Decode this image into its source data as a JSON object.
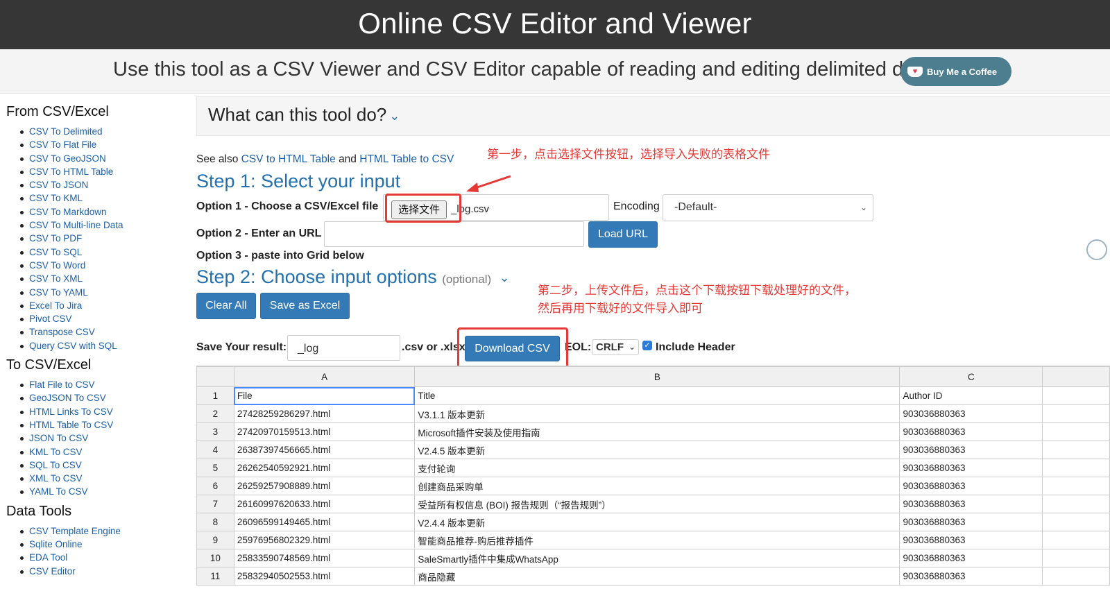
{
  "header": {
    "title": "Online CSV Editor and Viewer",
    "tagline": "Use this tool as a CSV Viewer and CSV Editor capable of reading and editing delimited data.",
    "coffee_label": "Buy Me a Coffee"
  },
  "sidebar": {
    "from_title": "From CSV/Excel",
    "from_items": [
      "CSV To Delimited",
      "CSV To Flat File",
      "CSV To GeoJSON",
      "CSV To HTML Table",
      "CSV To JSON",
      "CSV To KML",
      "CSV To Markdown",
      "CSV To Multi-line Data",
      "CSV To PDF",
      "CSV To SQL",
      "CSV To Word",
      "CSV To XML",
      "CSV To YAML",
      "Excel To Jira",
      "Pivot CSV",
      "Transpose CSV",
      "Query CSV with SQL"
    ],
    "to_title": "To CSV/Excel",
    "to_items": [
      "Flat File to CSV",
      "GeoJSON To CSV",
      "HTML Links To CSV",
      "HTML Table To CSV",
      "JSON To CSV",
      "KML To CSV",
      "SQL To CSV",
      "XML To CSV",
      "YAML To CSV"
    ],
    "tools_title": "Data Tools",
    "tools_items": [
      "CSV Template Engine",
      "Sqlite Online",
      "EDA Tool",
      "CSV Editor"
    ]
  },
  "panel": {
    "title": "What can this tool do?"
  },
  "see_also": {
    "prefix": "See also",
    "link1": "CSV to HTML Table",
    "and": "and",
    "link2": "HTML Table to CSV"
  },
  "step1": {
    "title": "Step 1: Select your input",
    "option1_label": "Option 1 - Choose a CSV/Excel file",
    "file_button": "选择文件",
    "file_name": "_log.csv",
    "encoding_label": "Encoding",
    "encoding_value": "-Default-",
    "option2_label": "Option 2 - Enter an URL",
    "url_value": "",
    "load_url": "Load URL",
    "option3_label": "Option 3 - paste into Grid below"
  },
  "step2": {
    "title": "Step 2: Choose input options",
    "optional": "(optional)",
    "clear_all": "Clear All",
    "save_excel": "Save as Excel"
  },
  "save": {
    "label": "Save Your result:",
    "filename": "_log",
    "suffix": ".csv or .xlsx",
    "download": "Download CSV",
    "eol_label": "EOL:",
    "eol_value": "CRLF",
    "include_header": "Include Header",
    "include_header_checked": true
  },
  "annotations": {
    "note1": "第一步，点击选择文件按钮，选择导入失败的表格文件",
    "note2_line1": "第二步，上传文件后，点击这个下载按钮下载处理好的文件，",
    "note2_line2": "然后再用下载好的文件导入即可",
    "color": "#e53935"
  },
  "grid": {
    "columns": [
      "A",
      "B",
      "C"
    ],
    "rows": [
      [
        "1",
        "File",
        "Title",
        "Author ID"
      ],
      [
        "2",
        "27428259286297.html",
        "V3.1.1 版本更新",
        "903036880363"
      ],
      [
        "3",
        "27420970159513.html",
        "Microsoft插件安装及使用指南",
        "903036880363"
      ],
      [
        "4",
        "26387397456665.html",
        "V2.4.5 版本更新",
        "903036880363"
      ],
      [
        "5",
        "26262540592921.html",
        "支付轮询",
        "903036880363"
      ],
      [
        "6",
        "26259257908889.html",
        "创建商品采购单",
        "903036880363"
      ],
      [
        "7",
        "26160997620633.html",
        "受益所有权信息 (BOI) 报告规则（“报告规则”）",
        "903036880363"
      ],
      [
        "8",
        "26096599149465.html",
        "V2.4.4 版本更新",
        "903036880363"
      ],
      [
        "9",
        "25976956802329.html",
        "智能商品推荐-购后推荐插件",
        "903036880363"
      ],
      [
        "10",
        "25833590748569.html",
        "SaleSmartly插件中集成WhatsApp",
        "903036880363"
      ],
      [
        "11",
        "25832940502553.html",
        "商品隐藏",
        "903036880363"
      ]
    ]
  }
}
